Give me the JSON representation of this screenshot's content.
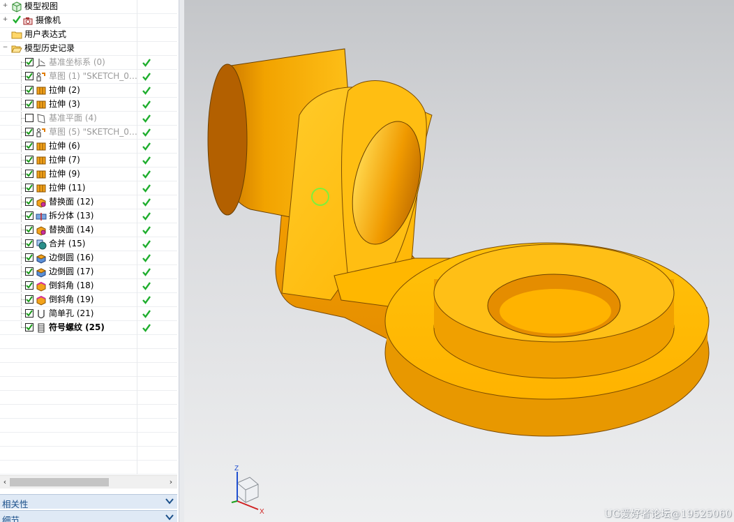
{
  "navigator": {
    "top_items": [
      {
        "label": "模型视图",
        "icon": "model-views-icon",
        "expander": "+"
      },
      {
        "label": "摄像机",
        "icon": "camera-icon",
        "expander": "+"
      },
      {
        "label": "用户表达式",
        "icon": "folder-icon",
        "expander": ""
      },
      {
        "label": "模型历史记录",
        "icon": "open-folder-icon",
        "expander": "−"
      }
    ],
    "features": [
      {
        "label": "基准坐标系 (0)",
        "icon": "datum-csys-icon",
        "checked": true,
        "greyed": true,
        "bold": false
      },
      {
        "label": "草图 (1) \"SKETCH_0…",
        "icon": "sketch-icon",
        "checked": true,
        "greyed": true,
        "bold": false
      },
      {
        "label": "拉伸 (2)",
        "icon": "extrude-icon",
        "checked": true,
        "greyed": false,
        "bold": false
      },
      {
        "label": "拉伸 (3)",
        "icon": "extrude-icon",
        "checked": true,
        "greyed": false,
        "bold": false
      },
      {
        "label": "基准平面 (4)",
        "icon": "datum-plane-icon",
        "checked": false,
        "greyed": true,
        "bold": false
      },
      {
        "label": "草图 (5) \"SKETCH_0…",
        "icon": "sketch-icon",
        "checked": true,
        "greyed": true,
        "bold": false
      },
      {
        "label": "拉伸 (6)",
        "icon": "extrude-icon",
        "checked": true,
        "greyed": false,
        "bold": false
      },
      {
        "label": "拉伸 (7)",
        "icon": "extrude-icon",
        "checked": true,
        "greyed": false,
        "bold": false
      },
      {
        "label": "拉伸 (9)",
        "icon": "extrude-icon",
        "checked": true,
        "greyed": false,
        "bold": false
      },
      {
        "label": "拉伸 (11)",
        "icon": "extrude-icon",
        "checked": true,
        "greyed": false,
        "bold": false
      },
      {
        "label": "替换面 (12)",
        "icon": "replace-face-icon",
        "checked": true,
        "greyed": false,
        "bold": false
      },
      {
        "label": "拆分体 (13)",
        "icon": "split-body-icon",
        "checked": true,
        "greyed": false,
        "bold": false
      },
      {
        "label": "替换面 (14)",
        "icon": "replace-face-icon",
        "checked": true,
        "greyed": false,
        "bold": false
      },
      {
        "label": "合并 (15)",
        "icon": "unite-icon",
        "checked": true,
        "greyed": false,
        "bold": false
      },
      {
        "label": "边倒圆 (16)",
        "icon": "edge-blend-icon",
        "checked": true,
        "greyed": false,
        "bold": false
      },
      {
        "label": "边倒圆 (17)",
        "icon": "edge-blend-icon",
        "checked": true,
        "greyed": false,
        "bold": false
      },
      {
        "label": "倒斜角 (18)",
        "icon": "chamfer-icon",
        "checked": true,
        "greyed": false,
        "bold": false
      },
      {
        "label": "倒斜角 (19)",
        "icon": "chamfer-icon",
        "checked": true,
        "greyed": false,
        "bold": false
      },
      {
        "label": "简单孔 (21)",
        "icon": "simple-hole-icon",
        "checked": true,
        "greyed": false,
        "bold": false
      },
      {
        "label": "符号螺纹 (25)",
        "icon": "symbolic-thread-icon",
        "checked": true,
        "greyed": false,
        "bold": true
      }
    ],
    "panels": [
      {
        "label": "相关性"
      },
      {
        "label": "细节"
      }
    ]
  },
  "viewport": {
    "triad": {
      "z_label": "Z",
      "x_label": "X"
    },
    "watermark": "UG爱好者论坛@19525060"
  },
  "colors": {
    "part_orange": "#FFB300",
    "status_green": "#1fae2e",
    "panel_title_blue": "#1a4f8a"
  }
}
